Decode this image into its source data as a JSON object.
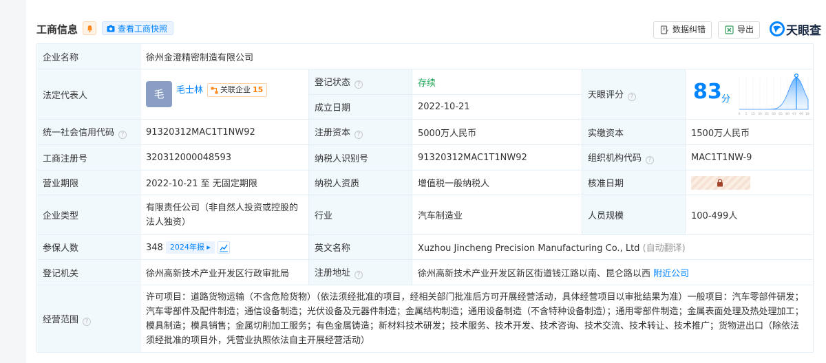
{
  "header": {
    "title": "工商信息",
    "snapshot_label": "查看工商快照",
    "correct_label": "数据纠错",
    "export_label": "导出",
    "logo_text": "天眼查"
  },
  "company_name": {
    "label": "企业名称",
    "value": "徐州金澄精密制造有限公司"
  },
  "legal_rep": {
    "label": "法定代表人",
    "avatar": "毛",
    "name": "毛士林",
    "badge_label": "关联企业",
    "badge_count": "15"
  },
  "reg_status": {
    "label": "登记状态",
    "value": "存续"
  },
  "found_date": {
    "label": "成立日期",
    "value": "2022-10-21"
  },
  "rating": {
    "label": "天眼评分",
    "score": "83",
    "unit": "分",
    "chart_ticks": [
      "0",
      "1",
      "15",
      "30",
      "45",
      "60",
      "65",
      "80",
      "97",
      "99",
      "100"
    ],
    "score_value": 83
  },
  "credit_code": {
    "label": "统一社会信用代码",
    "value": "91320312MAC1T1NW92"
  },
  "reg_capital": {
    "label": "注册资本",
    "value": "5000万人民币"
  },
  "paid_capital": {
    "label": "实缴资本",
    "value": "1500万人民币"
  },
  "reg_number": {
    "label": "工商注册号",
    "value": "320312000048593"
  },
  "taxpayer_id": {
    "label": "纳税人识别号",
    "value": "91320312MAC1T1NW92"
  },
  "org_code": {
    "label": "组织机构代码",
    "value": "MAC1T1NW-9"
  },
  "term": {
    "label": "营业期限",
    "value": "2022-10-21 至 无固定期限"
  },
  "taxpayer_qual": {
    "label": "纳税人资质",
    "value": "增值税一般纳税人"
  },
  "approve_date": {
    "label": "核准日期"
  },
  "company_type": {
    "label": "企业类型",
    "value": "有限责任公司（非自然人投资或控股的法人独资）"
  },
  "industry": {
    "label": "行业",
    "value": "汽车制造业"
  },
  "staff_size": {
    "label": "人员规模",
    "value": "100-499人"
  },
  "insured": {
    "label": "参保人数",
    "value": "348",
    "year_badge": "2024年报"
  },
  "english_name": {
    "label": "英文名称",
    "value": "Xuzhou Jincheng Precision Manufacturing Co., Ltd",
    "note": "(自动翻译)"
  },
  "authority": {
    "label": "登记机关",
    "value": "徐州高新技术产业开发区行政审批局"
  },
  "address": {
    "label": "注册地址",
    "value": "徐州高新技术产业开发区新区街道钱江路以南、昆仑路以西",
    "link": "附近公司"
  },
  "scope": {
    "label": "经营范围",
    "value": "许可项目：道路货物运输（不含危险货物）（依法须经批准的项目，经相关部门批准后方可开展经营活动，具体经营项目以审批结果为准）一般项目：汽车零部件研发；汽车零部件及配件制造；通信设备制造；光伏设备及元器件制造；金属结构制造；通用设备制造（不含特种设备制造）；通用零部件制造；金属表面处理及热处理加工；模具制造；模具销售；金属切削加工服务；有色金属铸造；新材料技术研发；技术服务、技术开发、技术咨询、技术交流、技术转让、技术推广；货物进出口（除依法须经批准的项目外，凭营业执照依法自主开展经营活动）"
  }
}
